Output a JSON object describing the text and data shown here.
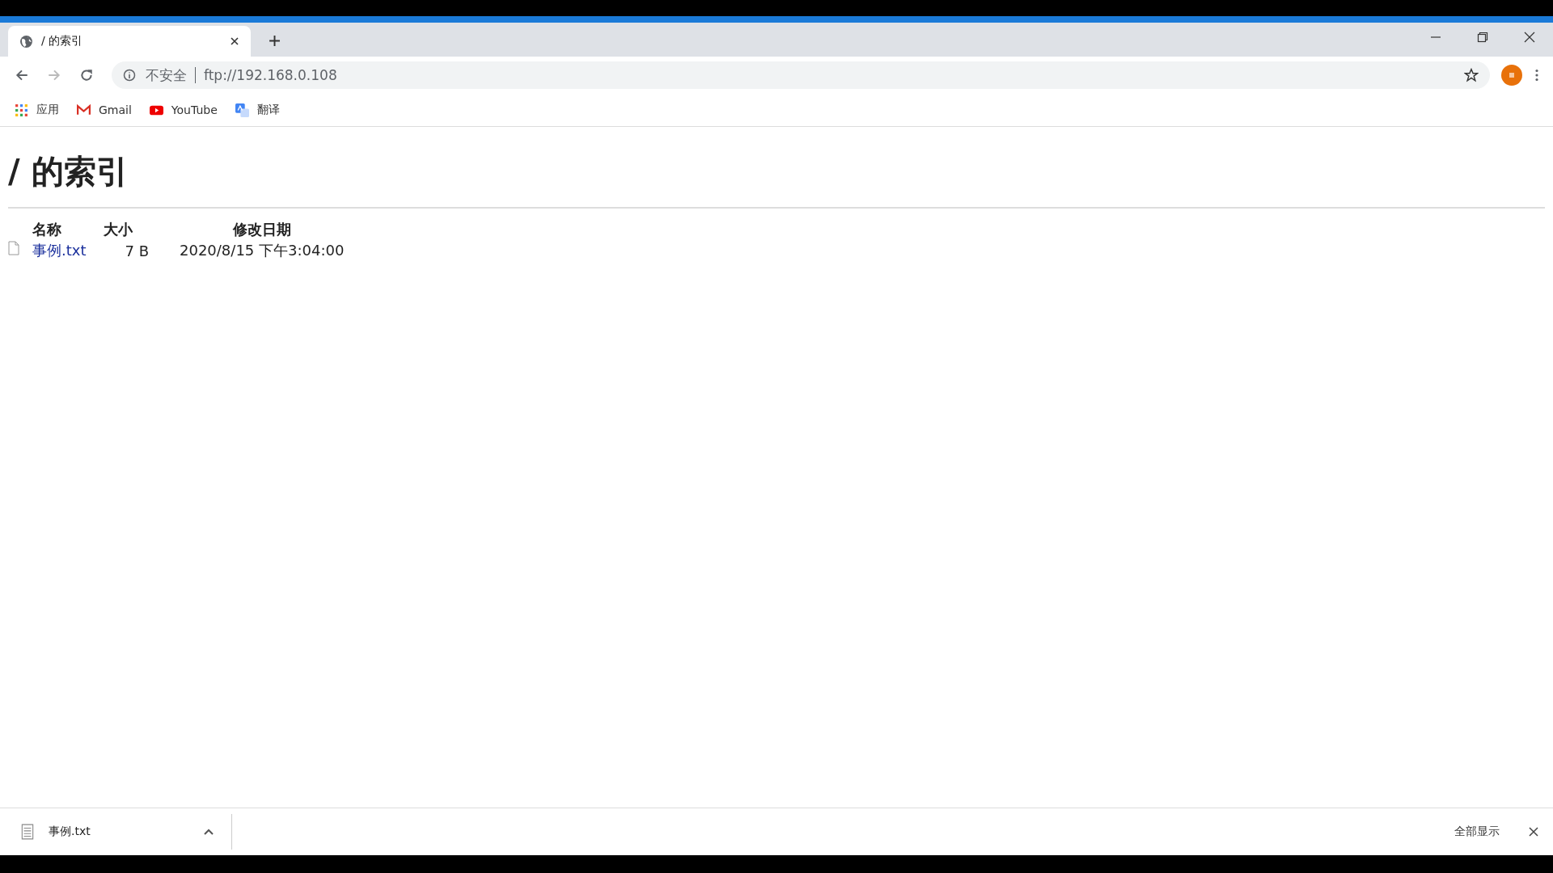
{
  "tabs": [
    {
      "title": "/ 的索引",
      "selected": true
    }
  ],
  "toolbar": {
    "security_label": "不安全",
    "url": "ftp://192.168.0.108"
  },
  "bookmarks": [
    {
      "kind": "apps",
      "label": "应用"
    },
    {
      "kind": "gmail",
      "label": "Gmail"
    },
    {
      "kind": "youtube",
      "label": "YouTube"
    },
    {
      "kind": "translate",
      "label": "翻译"
    }
  ],
  "page": {
    "heading": "/ 的索引",
    "table": {
      "columns": [
        "名称",
        "大小",
        "修改日期"
      ],
      "rows": [
        {
          "name": "事例.txt",
          "size": "7 B",
          "modified": "2020/8/15 下午3:04:00"
        }
      ]
    }
  },
  "download_bar": {
    "items": [
      {
        "name": "事例.txt"
      }
    ],
    "show_all": "全部显示"
  }
}
